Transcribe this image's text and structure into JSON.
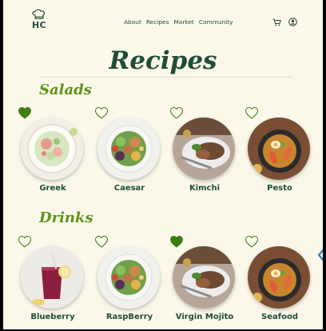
{
  "header": {
    "logo_text": "HC",
    "nav": [
      "About",
      "Recipes",
      "Market",
      "Community"
    ],
    "cart_icon": "cart-icon",
    "user_icon": "user-circle-icon"
  },
  "page_title": "Recipes",
  "sections": [
    {
      "title": "Salads",
      "items": [
        {
          "name": "Greek",
          "favorited": true
        },
        {
          "name": "Caesar",
          "favorited": false
        },
        {
          "name": "Kimchi",
          "favorited": false
        },
        {
          "name": "Pesto",
          "favorited": false
        }
      ]
    },
    {
      "title": "Drinks",
      "items": [
        {
          "name": "Blueberry",
          "favorited": false
        },
        {
          "name": "RaspBerry",
          "favorited": false
        },
        {
          "name": "Virgin Mojito",
          "favorited": true
        },
        {
          "name": "Seafood",
          "favorited": false
        }
      ]
    }
  ],
  "colors": {
    "background": "#fbf8ea",
    "heading": "#1f4d36",
    "section_title": "#5d9419",
    "heart": "#3f7d12",
    "arrow": "#2f7fd0"
  }
}
